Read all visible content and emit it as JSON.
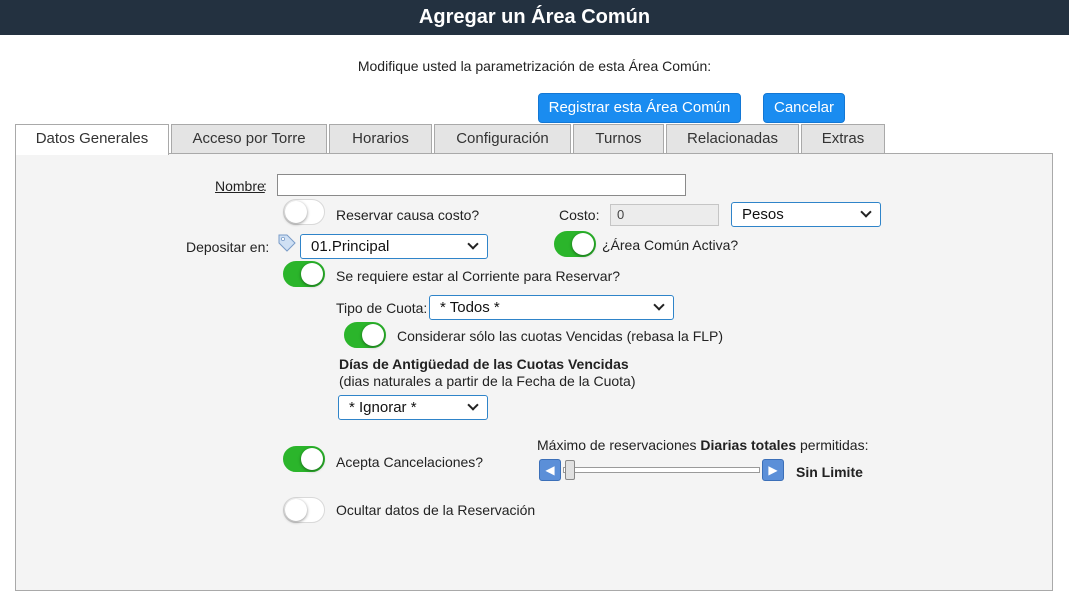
{
  "window": {
    "title": "Agregar un Área Común"
  },
  "header": {
    "subtitle": "Modifique usted la parametrización de esta Área Común:"
  },
  "actions": {
    "register_label": "Registrar esta Área Común",
    "cancel_label": "Cancelar"
  },
  "tabs": [
    {
      "label": "Datos Generales",
      "active": true
    },
    {
      "label": "Acceso por Torre",
      "active": false
    },
    {
      "label": "Horarios",
      "active": false
    },
    {
      "label": "Configuración",
      "active": false
    },
    {
      "label": "Turnos",
      "active": false
    },
    {
      "label": "Relacionadas",
      "active": false
    },
    {
      "label": "Extras",
      "active": false
    }
  ],
  "form": {
    "nombre_label": "Nombre",
    "nombre_value": "",
    "reservar_costo_label": "Reservar causa costo?",
    "reservar_costo_on": false,
    "costo_label": "Costo:",
    "costo_value": "0",
    "currency_selected": "Pesos",
    "depositar_label": "Depositar en:",
    "depositar_selected": "01.Principal",
    "activa_label": "¿Área Común Activa?",
    "activa_on": true,
    "corriente_label": "Se requiere estar al Corriente para Reservar?",
    "corriente_on": true,
    "tipo_cuota_label": "Tipo de Cuota:",
    "tipo_cuota_selected": "* Todos *",
    "vencidas_label": "Considerar sólo las cuotas Vencidas (rebasa la FLP)",
    "vencidas_on": true,
    "antiguedad_title": "Días de Antigüedad de las Cuotas Vencidas",
    "antiguedad_subtitle": "(dias naturales a partir de la Fecha de la Cuota)",
    "antiguedad_selected": "* Ignorar *",
    "cancelaciones_label": "Acepta Cancelaciones?",
    "cancelaciones_on": true,
    "max_reservas_prefix": "Máximo de reservaciones ",
    "max_reservas_bold": "Diarias totales",
    "max_reservas_suffix": " permitidas:",
    "max_reservas_value": "Sin Limite",
    "ocultar_label": "Ocultar datos de la Reservación",
    "ocultar_on": false
  },
  "icons": {
    "tag": "tag-icon",
    "chevron": "chevron-down-icon",
    "slider_left": "arrow-left-icon",
    "slider_right": "arrow-right-icon"
  },
  "colors": {
    "title_bar": "#233140",
    "accent_blue": "#1a8cf0",
    "toggle_on": "#2bb52b"
  }
}
